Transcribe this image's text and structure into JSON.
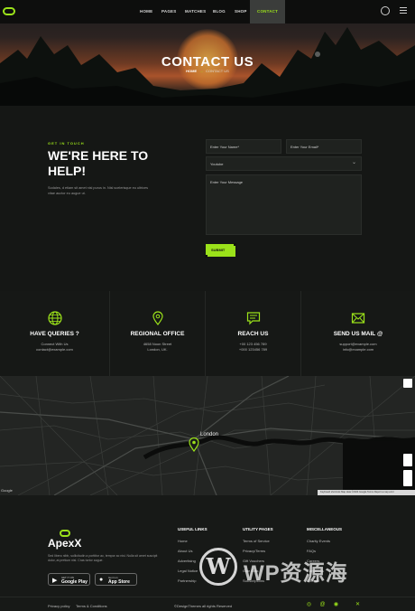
{
  "nav": {
    "items": [
      "HOME",
      "PAGES",
      "MATCHES",
      "BLOG",
      "SHOP",
      "CONTACT"
    ],
    "active": "CONTACT",
    "icons": [
      "search-icon",
      "menu-icon"
    ]
  },
  "hero": {
    "title": "CONTACT US",
    "breadcrumb_home": "HOME",
    "breadcrumb_sep": "→",
    "breadcrumb_current": "CONTACT US"
  },
  "contact": {
    "eyebrow": "GET IN TOUCH",
    "headline": "WE'RE HERE TO HELP!",
    "intro": "Sodales, d etiam sit amet nisl purus in. Nisl scelerisque eu ultrices vitae auctor eu augue ut.",
    "name_placeholder": "Enter Your Name*",
    "email_placeholder": "Enter Your Email*",
    "select_value": "Youtube",
    "message_placeholder": "Enter Your Message",
    "submit_label": "SUBMIT"
  },
  "info_cards": [
    {
      "icon": "globe-icon",
      "title": "HAVE QUERIES ?",
      "lines": [
        "Connect With Us",
        "contact@example.com"
      ]
    },
    {
      "icon": "location-pin-icon",
      "title": "REGIONAL OFFICE",
      "lines": [
        "4658 Noon Street",
        "London, UK."
      ]
    },
    {
      "icon": "chat-icon",
      "title": "REACH US",
      "lines": [
        "+00 123 456 789",
        "+000 123456 789"
      ]
    },
    {
      "icon": "mail-icon",
      "title": "SEND US MAIL @",
      "lines": [
        "support@example.com",
        "info@example.com"
      ]
    }
  ],
  "map": {
    "city": "London",
    "google": "Google",
    "attribution": "Keyboard shortcuts  Map data ©2024 Google  Terms  Report a map error"
  },
  "footer": {
    "brand": "ApexX",
    "desc": "Sed libero nibh, sollicitudin a porttitor ac, tempor ac nisi. Nulla sit amet suscipit dolor, at pretium nisl. Cras tortor augue.",
    "stores": [
      {
        "icon": "google-play-icon",
        "small": "GET IT ON",
        "big": "Google Play"
      },
      {
        "icon": "apple-icon",
        "small": "Get it on",
        "big": "App Store"
      }
    ],
    "columns": [
      {
        "title": "USEFUL LINKS",
        "links": [
          "Home",
          "About Us",
          "Advertising",
          "Legal Notice",
          "Partnership"
        ]
      },
      {
        "title": "UTILITY PAGES",
        "links": [
          "Terms of Service",
          "Privacy/Terms",
          "Gift Vouchers",
          "Give Gifts",
          "Subscriptions"
        ]
      },
      {
        "title": "MISCELLANEOUS",
        "links": [
          "Charity Events",
          "FAQs",
          "Careers",
          "Conditions",
          "Contact"
        ]
      }
    ],
    "bottom_links": [
      "Privacy policy",
      "Terms & Conditions"
    ],
    "copyright": "©DesignThemes all rights Reserved",
    "social_icons": [
      "instagram-icon",
      "threads-icon",
      "discord-icon",
      "x-icon"
    ]
  },
  "watermark": {
    "glyph": "W",
    "text": "WP资源海"
  },
  "colors": {
    "accent": "#9be21a",
    "bg": "#151715"
  }
}
